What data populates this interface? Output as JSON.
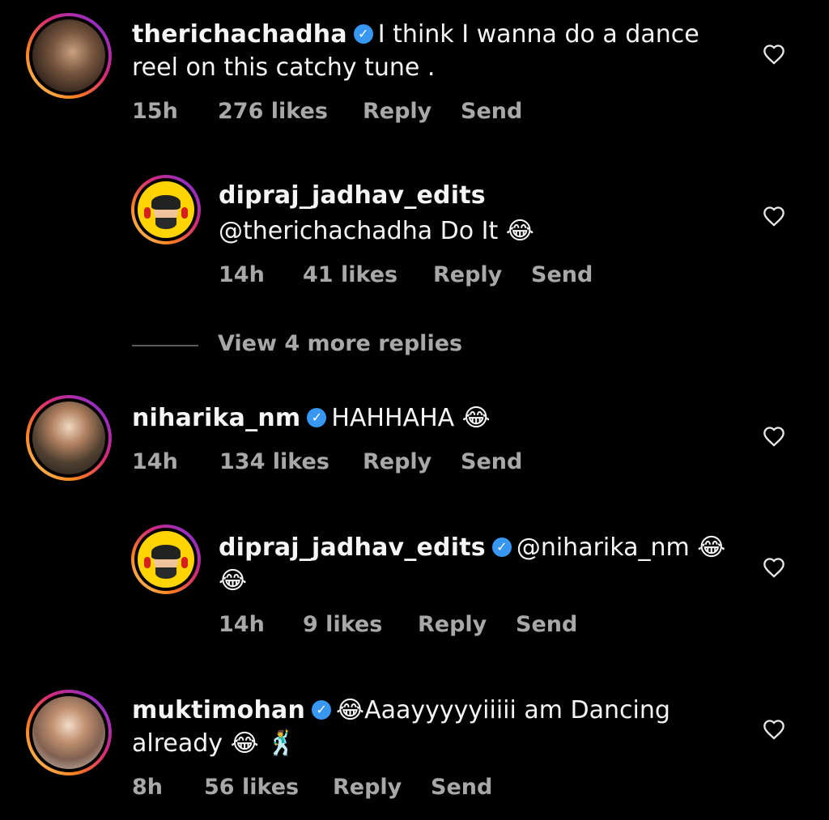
{
  "comments": [
    {
      "username": "therichachadha",
      "verified": true,
      "text": "I think I wanna do a dance reel on  this catchy tune .",
      "time": "15h",
      "likes": "276 likes",
      "reply": "Reply",
      "send": "Send"
    },
    {
      "username": "dipraj_jadhav_edits",
      "verified": false,
      "text": "@therichachadha Do It 😂",
      "time": "14h",
      "likes": "41 likes",
      "reply": "Reply",
      "send": "Send"
    },
    {
      "username": "niharika_nm",
      "verified": true,
      "text": "HAHHAHA 😂",
      "time": "14h",
      "likes": "134 likes",
      "reply": "Reply",
      "send": "Send"
    },
    {
      "username": "dipraj_jadhav_edits",
      "verified": true,
      "text": "@niharika_nm 😂😂",
      "time": "14h",
      "likes": "9 likes",
      "reply": "Reply",
      "send": "Send"
    },
    {
      "username": "muktimohan",
      "verified": true,
      "text": "😂Aaayyyyyiiiii am Dancing already 😂 🕺",
      "time": "8h",
      "likes": "56 likes",
      "reply": "Reply",
      "send": "Send"
    }
  ],
  "view_more_replies": "View 4 more replies",
  "icons": {
    "heart": "heart-outline-icon",
    "verified": "verified-badge-icon"
  },
  "colors": {
    "background": "#000000",
    "text": "#f5f5f5",
    "meta": "#a8a8a8",
    "verified": "#3897f0"
  }
}
